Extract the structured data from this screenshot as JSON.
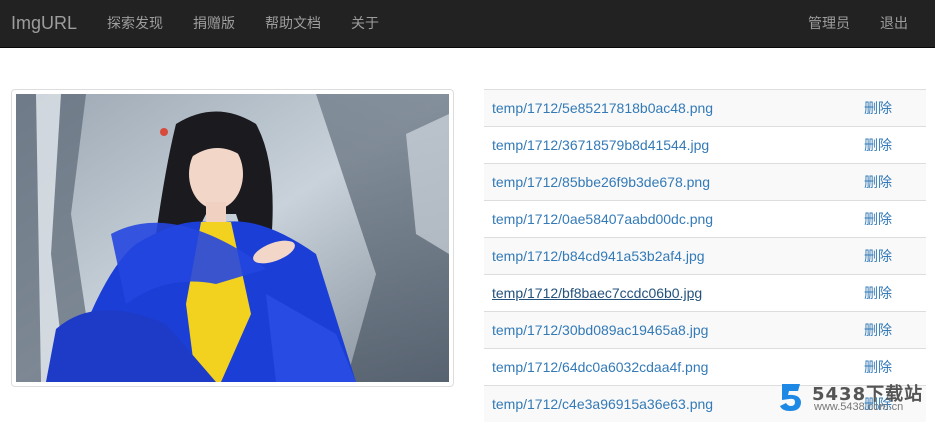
{
  "navbar": {
    "brand": "ImgURL",
    "left": [
      "探索发现",
      "捐赠版",
      "帮助文档",
      "关于"
    ],
    "right": [
      "管理员",
      "退出"
    ]
  },
  "files": [
    {
      "path": "temp/1712/5e85217818b0ac48.png",
      "action": "删除"
    },
    {
      "path": "temp/1712/36718579b8d41544.jpg",
      "action": "删除"
    },
    {
      "path": "temp/1712/85bbe26f9b3de678.png",
      "action": "删除"
    },
    {
      "path": "temp/1712/0ae58407aabd00dc.png",
      "action": "删除"
    },
    {
      "path": "temp/1712/b84cd941a53b2af4.jpg",
      "action": "删除"
    },
    {
      "path": "temp/1712/bf8baec7ccdc06b0.jpg",
      "action": "删除",
      "hover": true
    },
    {
      "path": "temp/1712/30bd089ac19465a8.jpg",
      "action": "删除"
    },
    {
      "path": "temp/1712/64dc0a6032cdaa4f.png",
      "action": "删除"
    },
    {
      "path": "temp/1712/c4e3a96915a36e63.png",
      "action": "删除"
    }
  ],
  "watermark": {
    "title": "5438下载站",
    "url": "www.5438.com.cn"
  },
  "colors": {
    "navbar_bg": "#222222",
    "nav_text": "#9d9d9d",
    "link": "#337ab7"
  }
}
